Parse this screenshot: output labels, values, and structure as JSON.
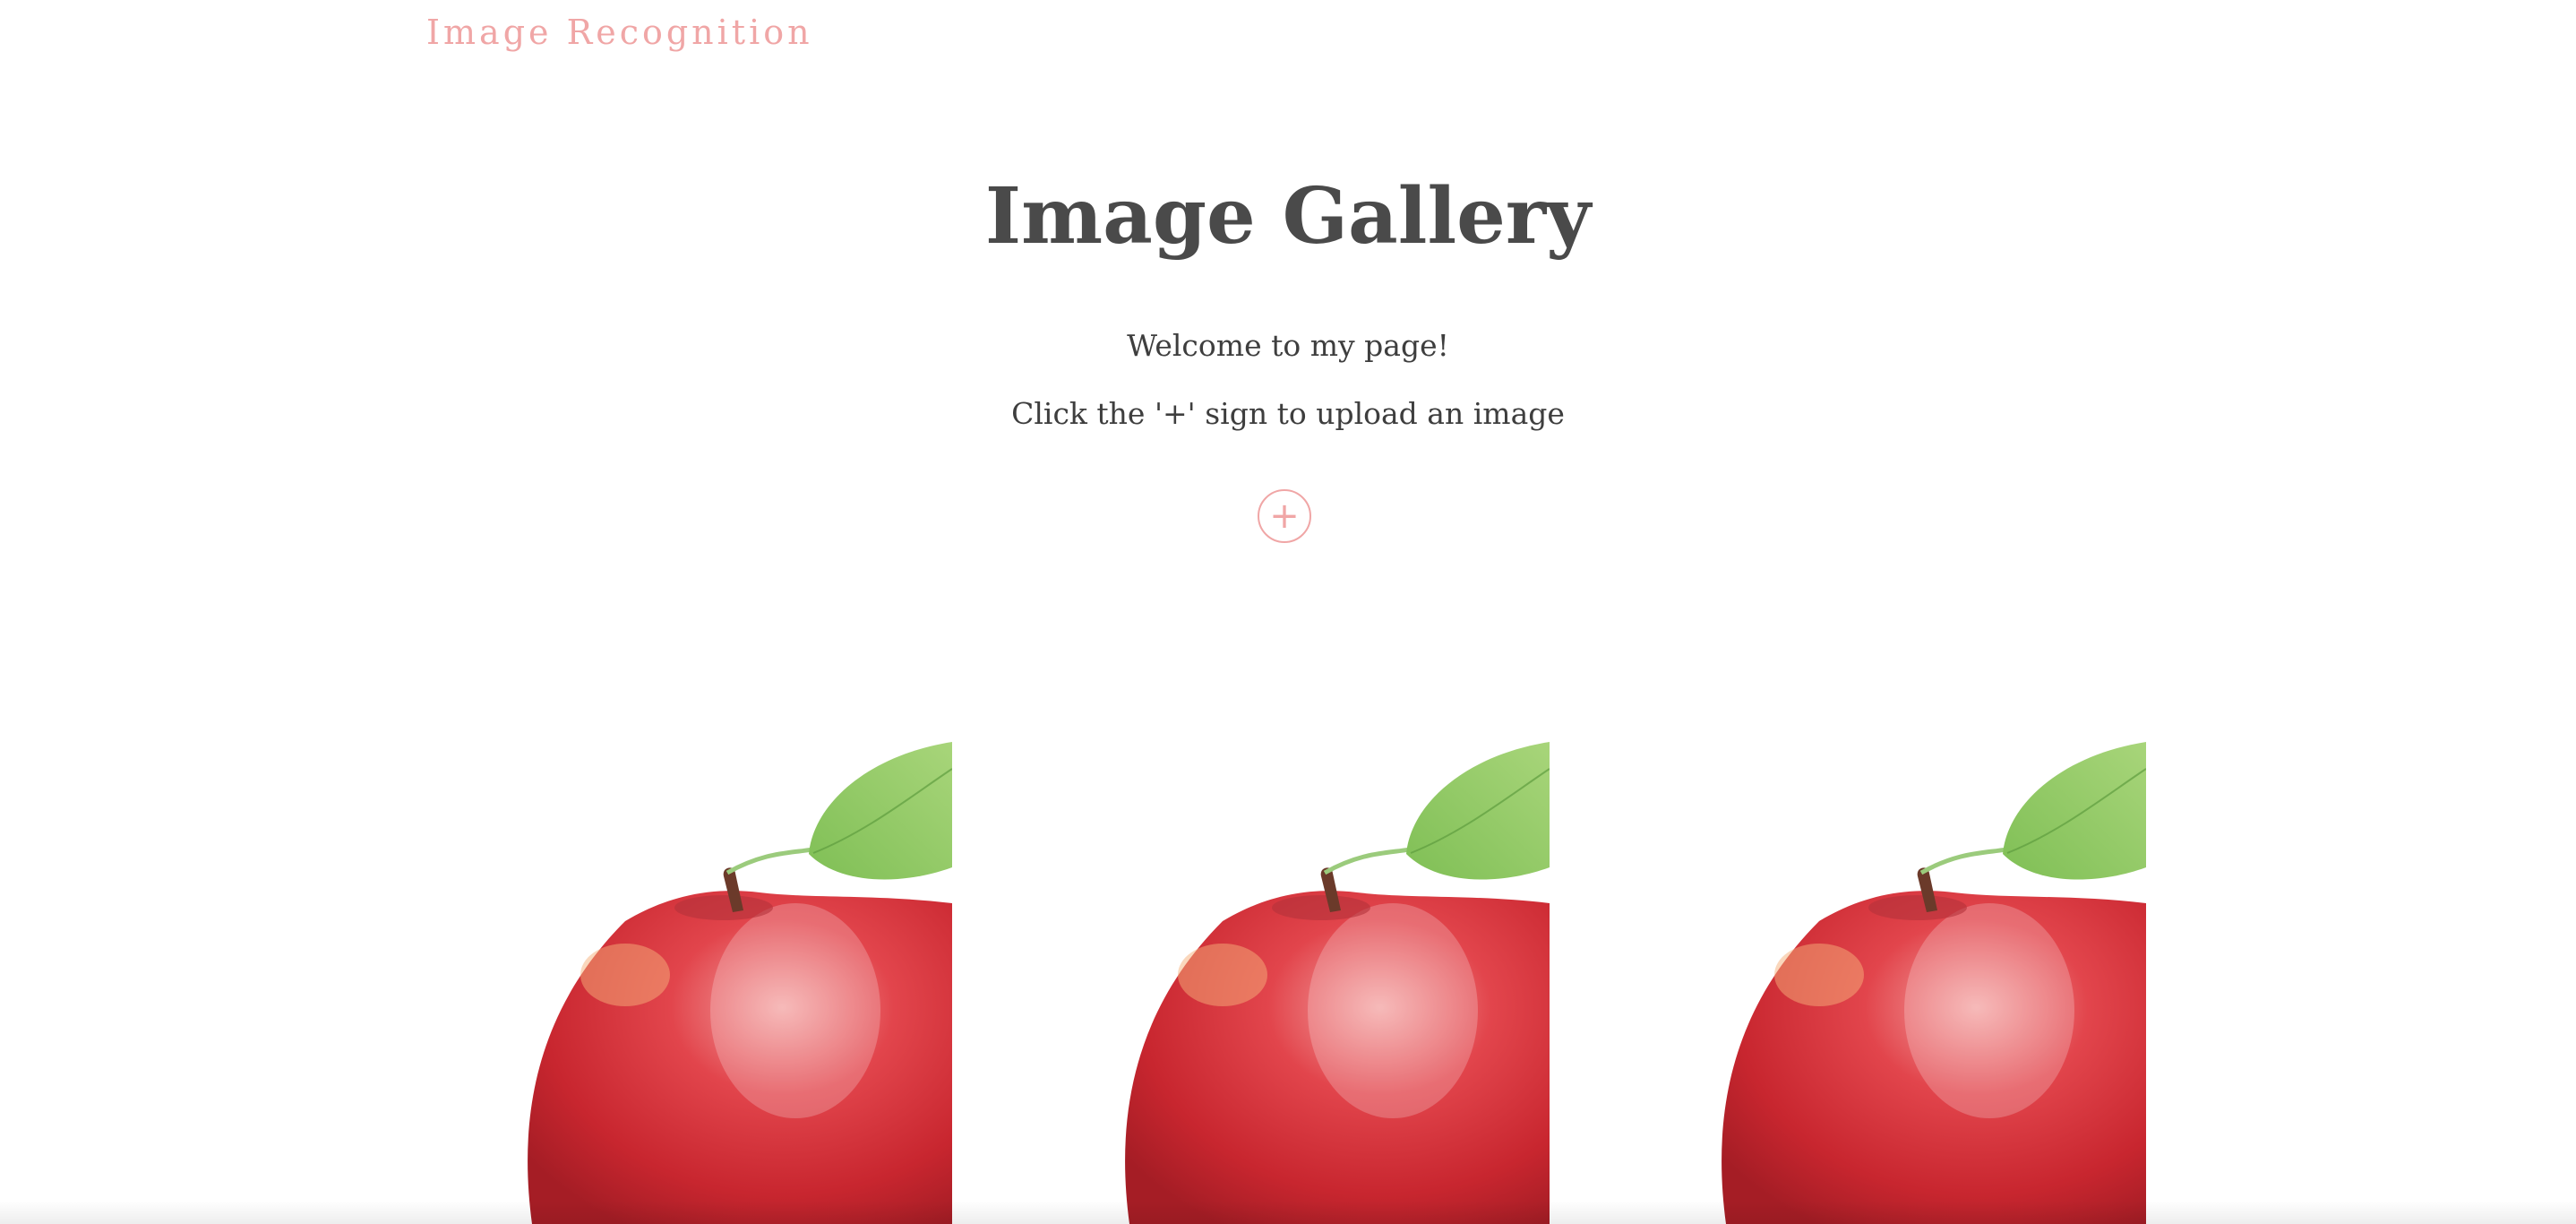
{
  "header": {
    "brand": "Image Recognition"
  },
  "main": {
    "title": "Image Gallery",
    "welcome": "Welcome to my page!",
    "instruction": "Click the '+' sign to upload an image",
    "upload_button_label": "+"
  },
  "gallery": {
    "items": [
      {
        "image": "red-apple-photo"
      },
      {
        "image": "red-apple-photo"
      },
      {
        "image": "red-apple-photo"
      }
    ]
  },
  "colors": {
    "accent": "#f0a6a6",
    "title": "#4a4a4a",
    "text": "#3e3e3e",
    "background": "#ffffff"
  }
}
